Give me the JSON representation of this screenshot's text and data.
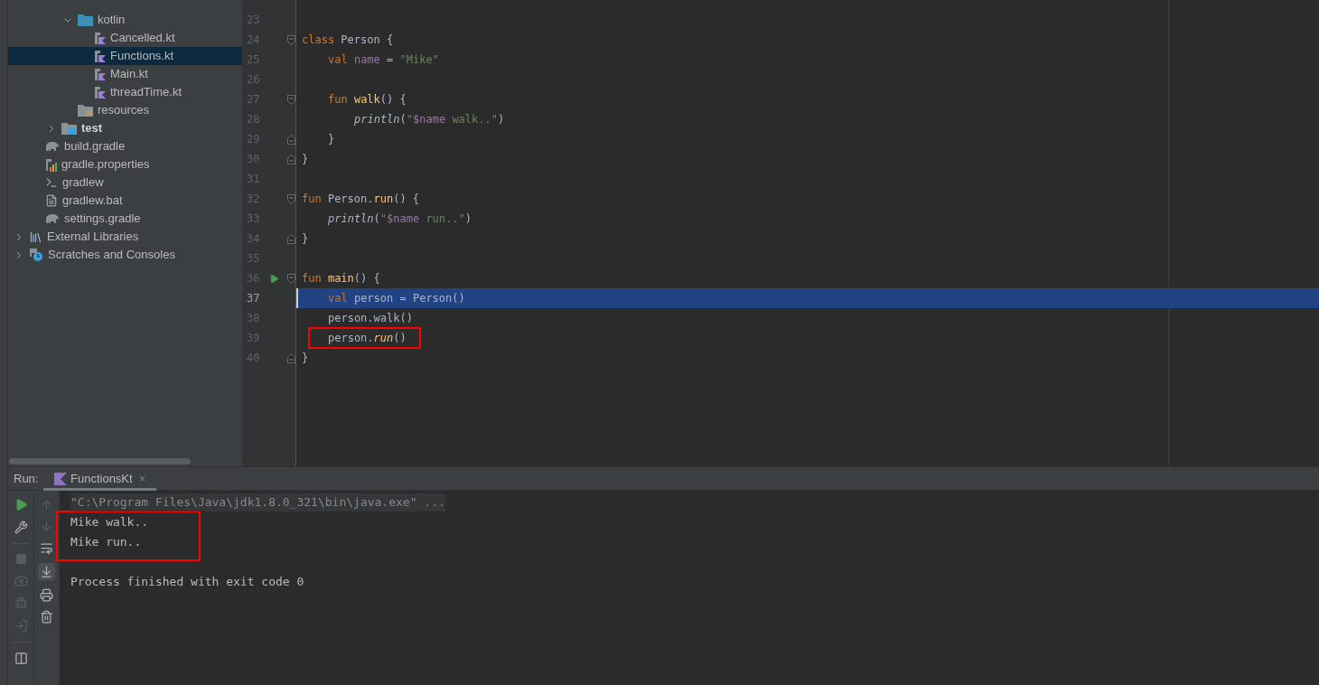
{
  "project_tree": [
    {
      "children": [
        {
          "children": [
            {
              "children": [
                {
                  "label": "kotlin",
                  "kind": "source-folder",
                  "bold": false,
                  "expanded": true,
                  "children": [
                    {
                      "label": "Cancelled.kt",
                      "kind": "kotlin-file",
                      "bold": false,
                      "selected": false
                    },
                    {
                      "label": "Functions.kt",
                      "kind": "kotlin-file",
                      "bold": false,
                      "selected": true
                    },
                    {
                      "label": "Main.kt",
                      "kind": "kotlin-file",
                      "bold": false,
                      "selected": false
                    },
                    {
                      "label": "threadTime.kt",
                      "kind": "kotlin-file",
                      "bold": false,
                      "selected": false
                    }
                  ]
                },
                {
                  "label": "resources",
                  "kind": "resources-folder",
                  "bold": false,
                  "selected": false
                }
              ]
            },
            {
              "label": "test",
              "kind": "module-folder",
              "bold": true,
              "expanded": false
            }
          ]
        },
        {
          "label": "build.gradle",
          "kind": "gradle",
          "bold": false,
          "selected": false
        },
        {
          "label": "gradle.properties",
          "kind": "properties",
          "bold": false,
          "selected": false
        },
        {
          "label": "gradlew",
          "kind": "script",
          "bold": false,
          "selected": false
        },
        {
          "label": "gradlew.bat",
          "kind": "text-file",
          "bold": false,
          "selected": false
        },
        {
          "label": "settings.gradle",
          "kind": "gradle",
          "bold": false,
          "selected": false
        }
      ]
    },
    {
      "label": "External Libraries",
      "kind": "libraries",
      "bold": false,
      "expanded": false
    },
    {
      "label": "Scratches and Consoles",
      "kind": "scratches",
      "bold": false,
      "expanded": false
    }
  ],
  "editor": {
    "lines": [
      {
        "number": "23"
      },
      {
        "number": "24",
        "fold_open": true,
        "tokens": [
          {
            "kind": "keyword",
            "text": "class "
          },
          {
            "kind": "plain",
            "text": "Person {"
          }
        ],
        "children": [
          {
            "number": "25",
            "tokens": [
              {
                "kind": "keyword",
                "text": "val "
              },
              {
                "kind": "property",
                "text": "name"
              },
              {
                "kind": "plain",
                "text": " = "
              },
              {
                "kind": "string",
                "text": "\"Mike\""
              }
            ]
          },
          {
            "number": "26"
          },
          {
            "number": "27",
            "fold_open": true,
            "tokens": [
              {
                "kind": "keyword",
                "text": "fun "
              },
              {
                "kind": "function",
                "text": "walk"
              },
              {
                "kind": "plain",
                "text": "() {"
              }
            ],
            "children": [
              {
                "number": "28",
                "tokens": [
                  {
                    "kind": "call",
                    "text": "println"
                  },
                  {
                    "kind": "plain",
                    "text": "("
                  },
                  {
                    "kind": "string",
                    "text": "\""
                  },
                  {
                    "kind": "property",
                    "text": "$name"
                  },
                  {
                    "kind": "string",
                    "text": " walk..\""
                  },
                  {
                    "kind": "plain",
                    "text": ")"
                  }
                ]
              }
            ]
          },
          {
            "number": "29",
            "fold_close": true,
            "tokens": [
              {
                "kind": "plain",
                "text": "}"
              }
            ]
          }
        ]
      },
      {
        "number": "30",
        "fold_close": true,
        "tokens": [
          {
            "kind": "plain",
            "text": "}"
          }
        ]
      },
      {
        "number": "31"
      },
      {
        "number": "32",
        "fold_open": true,
        "tokens": [
          {
            "kind": "keyword",
            "text": "fun "
          },
          {
            "kind": "plain",
            "text": "Person."
          },
          {
            "kind": "function",
            "text": "run"
          },
          {
            "kind": "plain",
            "text": "() {"
          }
        ],
        "children": [
          {
            "number": "33",
            "tokens": [
              {
                "kind": "call",
                "text": "println"
              },
              {
                "kind": "plain",
                "text": "("
              },
              {
                "kind": "string",
                "text": "\""
              },
              {
                "kind": "property",
                "text": "$name"
              },
              {
                "kind": "string",
                "text": " run..\""
              },
              {
                "kind": "plain",
                "text": ")"
              }
            ]
          }
        ]
      },
      {
        "number": "34",
        "fold_close": true,
        "tokens": [
          {
            "kind": "plain",
            "text": "}"
          }
        ]
      },
      {
        "number": "35"
      },
      {
        "number": "36",
        "fold_open": true,
        "runnable": true,
        "tokens": [
          {
            "kind": "keyword",
            "text": "fun "
          },
          {
            "kind": "function",
            "text": "main"
          },
          {
            "kind": "plain",
            "text": "() {"
          }
        ],
        "children": [
          {
            "number": "37",
            "current": true,
            "tokens": [
              {
                "kind": "keyword",
                "text": "val "
              },
              {
                "kind": "plain",
                "text": "person = Person()"
              }
            ]
          },
          {
            "number": "38",
            "tokens": [
              {
                "kind": "plain",
                "text": "person.walk()"
              }
            ]
          },
          {
            "number": "39",
            "boxed": true,
            "tokens": [
              {
                "kind": "plain",
                "text": "person."
              },
              {
                "kind": "extension-call",
                "text": "run"
              },
              {
                "kind": "plain",
                "text": "()"
              }
            ]
          }
        ]
      },
      {
        "number": "40",
        "fold_close": true,
        "tokens": [
          {
            "kind": "plain",
            "text": "}"
          }
        ]
      }
    ]
  },
  "run_panel": {
    "label": "Run:",
    "tabs": [
      {
        "label": "FunctionsKt",
        "close": "×",
        "selected": true
      }
    ],
    "console": {
      "command": "\"C:\\Program Files\\Java\\jdk1.8.0_321\\bin\\java.exe\" ...",
      "output_box": {
        "boxed": true,
        "lines": [
          "Mike walk..",
          "Mike run.."
        ]
      },
      "status": "Process finished with exit code 0"
    }
  }
}
